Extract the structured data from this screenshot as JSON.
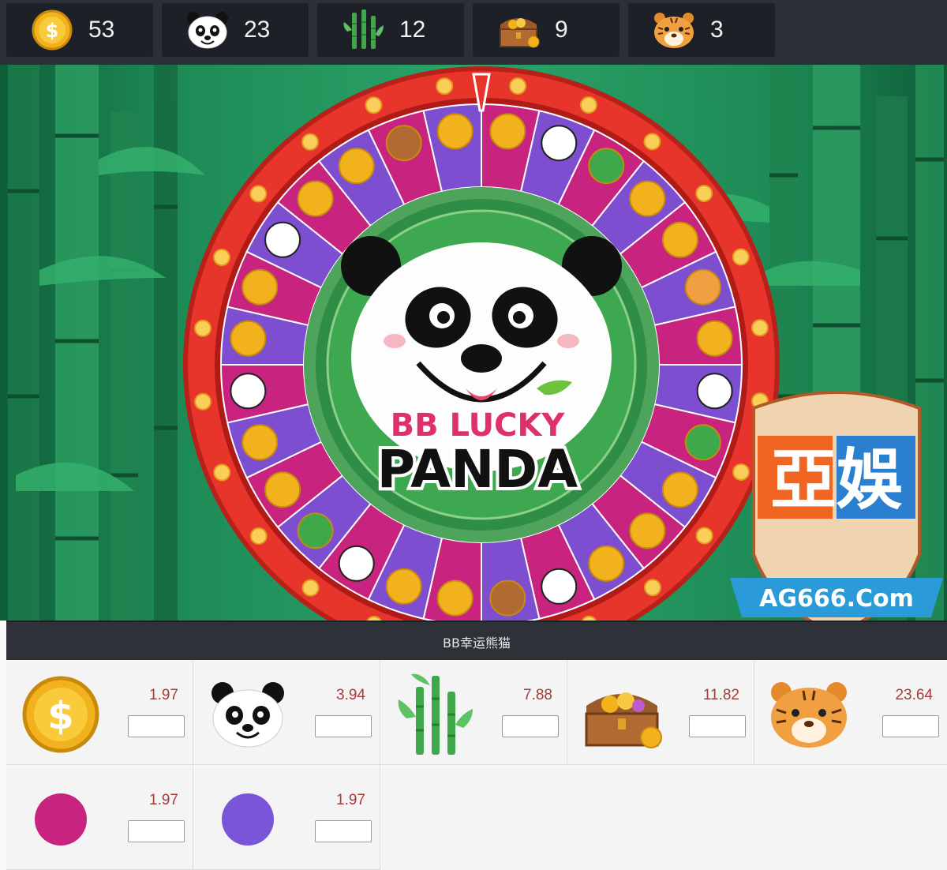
{
  "stats": [
    {
      "icon": "coin-icon",
      "count": "53"
    },
    {
      "icon": "panda-icon",
      "count": "23"
    },
    {
      "icon": "bamboo-icon",
      "count": "12"
    },
    {
      "icon": "treasure-chest-icon",
      "count": "9"
    },
    {
      "icon": "tiger-icon",
      "count": "3"
    }
  ],
  "game": {
    "logo_line1": "BB LUCKY",
    "logo_line2": "PANDA",
    "watermark_main": "亞娛",
    "watermark_site": "AG666.Com"
  },
  "bet_panel": {
    "title": "BB幸运熊猫",
    "options": [
      {
        "icon": "coin-icon",
        "odds": "1.97",
        "input_value": ""
      },
      {
        "icon": "panda-icon",
        "odds": "3.94",
        "input_value": ""
      },
      {
        "icon": "bamboo-icon",
        "odds": "7.88",
        "input_value": ""
      },
      {
        "icon": "treasure-chest-icon",
        "odds": "11.82",
        "input_value": ""
      },
      {
        "icon": "tiger-icon",
        "odds": "23.64",
        "input_value": ""
      },
      {
        "icon": "magenta-circle-icon",
        "odds": "1.97",
        "input_value": ""
      },
      {
        "icon": "purple-circle-icon",
        "odds": "1.97",
        "input_value": ""
      }
    ]
  },
  "colors": {
    "wheel_rim": "#e8352b",
    "segment_magenta": "#c8237e",
    "segment_purple": "#7d4ed0",
    "bamboo_green": "#2aa468",
    "odds_text": "#a83a3a",
    "magenta_bet": "#c8237e",
    "purple_bet": "#7a55d8"
  }
}
